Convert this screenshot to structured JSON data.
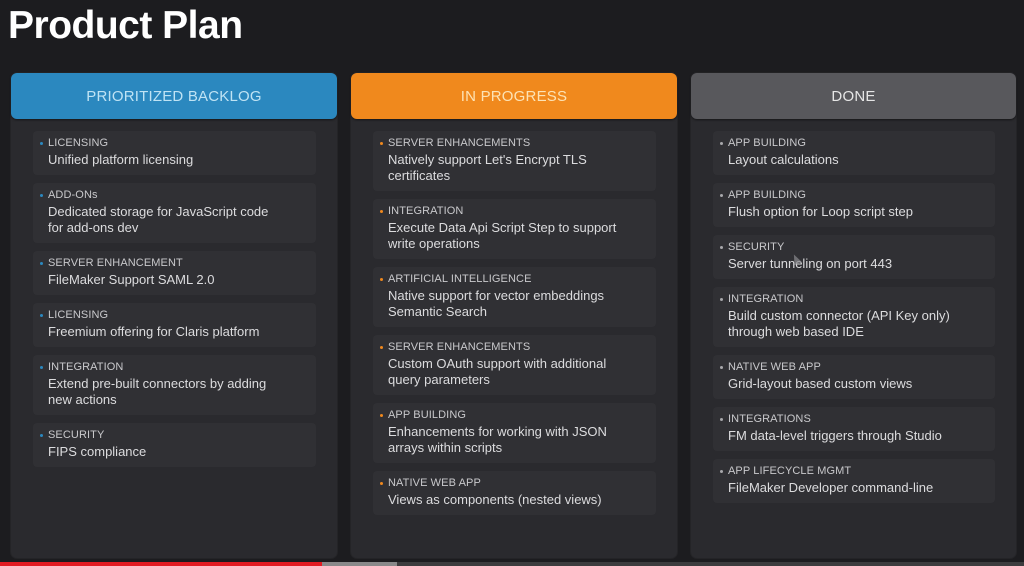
{
  "page": {
    "title": "Product Plan"
  },
  "columns": [
    {
      "header": "PRIORITIZED BACKLOG",
      "accent": "#2b88bf",
      "cards": [
        {
          "tag": "LICENSING",
          "title": "Unified platform licensing"
        },
        {
          "tag": "ADD-ONs",
          "title": "Dedicated storage for JavaScript code for add-ons dev"
        },
        {
          "tag": "SERVER ENHANCEMENT",
          "title": "FileMaker Support SAML 2.0"
        },
        {
          "tag": "LICENSING",
          "title": "Freemium offering for Claris platform"
        },
        {
          "tag": "INTEGRATION",
          "title": "Extend pre-built connectors by adding new actions"
        },
        {
          "tag": "SECURITY",
          "title": "FIPS compliance"
        }
      ]
    },
    {
      "header": "IN PROGRESS",
      "accent": "#f0891d",
      "cards": [
        {
          "tag": "SERVER ENHANCEMENTS",
          "title": "Natively support Let's Encrypt TLS certificates"
        },
        {
          "tag": "INTEGRATION",
          "title": "Execute Data Api Script Step to support write operations"
        },
        {
          "tag": "ARTIFICIAL INTELLIGENCE",
          "title": "Native support for vector embeddings Semantic Search"
        },
        {
          "tag": "SERVER ENHANCEMENTS",
          "title": "Custom OAuth support with additional query parameters"
        },
        {
          "tag": "APP BUILDING",
          "title": "Enhancements for working with JSON arrays within scripts"
        },
        {
          "tag": "NATIVE WEB APP",
          "title": "Views as components (nested views)"
        }
      ]
    },
    {
      "header": "DONE",
      "accent": "#58585c",
      "cards": [
        {
          "tag": "APP BUILDING",
          "title": "Layout calculations"
        },
        {
          "tag": "APP BUILDING",
          "title": "Flush option for Loop script step"
        },
        {
          "tag": "SECURITY",
          "title": "Server tunneling on port 443"
        },
        {
          "tag": "INTEGRATION",
          "title": "Build custom connector (API Key only) through web based IDE"
        },
        {
          "tag": "NATIVE WEB APP",
          "title": "Grid-layout based custom views"
        },
        {
          "tag": "INTEGRATIONS",
          "title": "FM data-level triggers through Studio"
        },
        {
          "tag": "APP LIFECYCLE MGMT",
          "title": "FileMaker Developer command-line"
        }
      ]
    }
  ],
  "video_player": {
    "played_fraction": 0.314,
    "buffered_fraction": 0.388,
    "played_color": "#e21c23"
  }
}
